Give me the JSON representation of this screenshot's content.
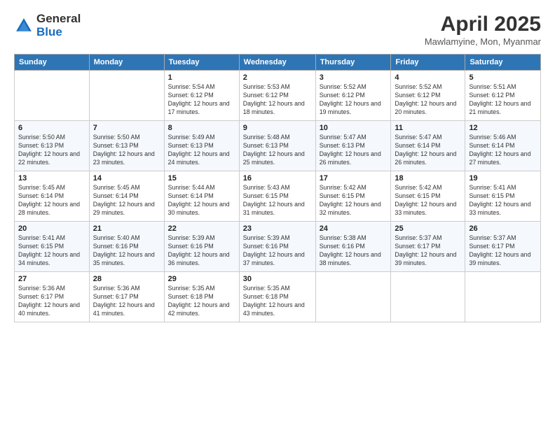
{
  "header": {
    "logo_general": "General",
    "logo_blue": "Blue",
    "month_title": "April 2025",
    "location": "Mawlamyine, Mon, Myanmar"
  },
  "days_of_week": [
    "Sunday",
    "Monday",
    "Tuesday",
    "Wednesday",
    "Thursday",
    "Friday",
    "Saturday"
  ],
  "weeks": [
    [
      {
        "num": "",
        "info": ""
      },
      {
        "num": "",
        "info": ""
      },
      {
        "num": "1",
        "info": "Sunrise: 5:54 AM\nSunset: 6:12 PM\nDaylight: 12 hours and 17 minutes."
      },
      {
        "num": "2",
        "info": "Sunrise: 5:53 AM\nSunset: 6:12 PM\nDaylight: 12 hours and 18 minutes."
      },
      {
        "num": "3",
        "info": "Sunrise: 5:52 AM\nSunset: 6:12 PM\nDaylight: 12 hours and 19 minutes."
      },
      {
        "num": "4",
        "info": "Sunrise: 5:52 AM\nSunset: 6:12 PM\nDaylight: 12 hours and 20 minutes."
      },
      {
        "num": "5",
        "info": "Sunrise: 5:51 AM\nSunset: 6:12 PM\nDaylight: 12 hours and 21 minutes."
      }
    ],
    [
      {
        "num": "6",
        "info": "Sunrise: 5:50 AM\nSunset: 6:13 PM\nDaylight: 12 hours and 22 minutes."
      },
      {
        "num": "7",
        "info": "Sunrise: 5:50 AM\nSunset: 6:13 PM\nDaylight: 12 hours and 23 minutes."
      },
      {
        "num": "8",
        "info": "Sunrise: 5:49 AM\nSunset: 6:13 PM\nDaylight: 12 hours and 24 minutes."
      },
      {
        "num": "9",
        "info": "Sunrise: 5:48 AM\nSunset: 6:13 PM\nDaylight: 12 hours and 25 minutes."
      },
      {
        "num": "10",
        "info": "Sunrise: 5:47 AM\nSunset: 6:13 PM\nDaylight: 12 hours and 26 minutes."
      },
      {
        "num": "11",
        "info": "Sunrise: 5:47 AM\nSunset: 6:14 PM\nDaylight: 12 hours and 26 minutes."
      },
      {
        "num": "12",
        "info": "Sunrise: 5:46 AM\nSunset: 6:14 PM\nDaylight: 12 hours and 27 minutes."
      }
    ],
    [
      {
        "num": "13",
        "info": "Sunrise: 5:45 AM\nSunset: 6:14 PM\nDaylight: 12 hours and 28 minutes."
      },
      {
        "num": "14",
        "info": "Sunrise: 5:45 AM\nSunset: 6:14 PM\nDaylight: 12 hours and 29 minutes."
      },
      {
        "num": "15",
        "info": "Sunrise: 5:44 AM\nSunset: 6:14 PM\nDaylight: 12 hours and 30 minutes."
      },
      {
        "num": "16",
        "info": "Sunrise: 5:43 AM\nSunset: 6:15 PM\nDaylight: 12 hours and 31 minutes."
      },
      {
        "num": "17",
        "info": "Sunrise: 5:42 AM\nSunset: 6:15 PM\nDaylight: 12 hours and 32 minutes."
      },
      {
        "num": "18",
        "info": "Sunrise: 5:42 AM\nSunset: 6:15 PM\nDaylight: 12 hours and 33 minutes."
      },
      {
        "num": "19",
        "info": "Sunrise: 5:41 AM\nSunset: 6:15 PM\nDaylight: 12 hours and 33 minutes."
      }
    ],
    [
      {
        "num": "20",
        "info": "Sunrise: 5:41 AM\nSunset: 6:15 PM\nDaylight: 12 hours and 34 minutes."
      },
      {
        "num": "21",
        "info": "Sunrise: 5:40 AM\nSunset: 6:16 PM\nDaylight: 12 hours and 35 minutes."
      },
      {
        "num": "22",
        "info": "Sunrise: 5:39 AM\nSunset: 6:16 PM\nDaylight: 12 hours and 36 minutes."
      },
      {
        "num": "23",
        "info": "Sunrise: 5:39 AM\nSunset: 6:16 PM\nDaylight: 12 hours and 37 minutes."
      },
      {
        "num": "24",
        "info": "Sunrise: 5:38 AM\nSunset: 6:16 PM\nDaylight: 12 hours and 38 minutes."
      },
      {
        "num": "25",
        "info": "Sunrise: 5:37 AM\nSunset: 6:17 PM\nDaylight: 12 hours and 39 minutes."
      },
      {
        "num": "26",
        "info": "Sunrise: 5:37 AM\nSunset: 6:17 PM\nDaylight: 12 hours and 39 minutes."
      }
    ],
    [
      {
        "num": "27",
        "info": "Sunrise: 5:36 AM\nSunset: 6:17 PM\nDaylight: 12 hours and 40 minutes."
      },
      {
        "num": "28",
        "info": "Sunrise: 5:36 AM\nSunset: 6:17 PM\nDaylight: 12 hours and 41 minutes."
      },
      {
        "num": "29",
        "info": "Sunrise: 5:35 AM\nSunset: 6:18 PM\nDaylight: 12 hours and 42 minutes."
      },
      {
        "num": "30",
        "info": "Sunrise: 5:35 AM\nSunset: 6:18 PM\nDaylight: 12 hours and 43 minutes."
      },
      {
        "num": "",
        "info": ""
      },
      {
        "num": "",
        "info": ""
      },
      {
        "num": "",
        "info": ""
      }
    ]
  ]
}
